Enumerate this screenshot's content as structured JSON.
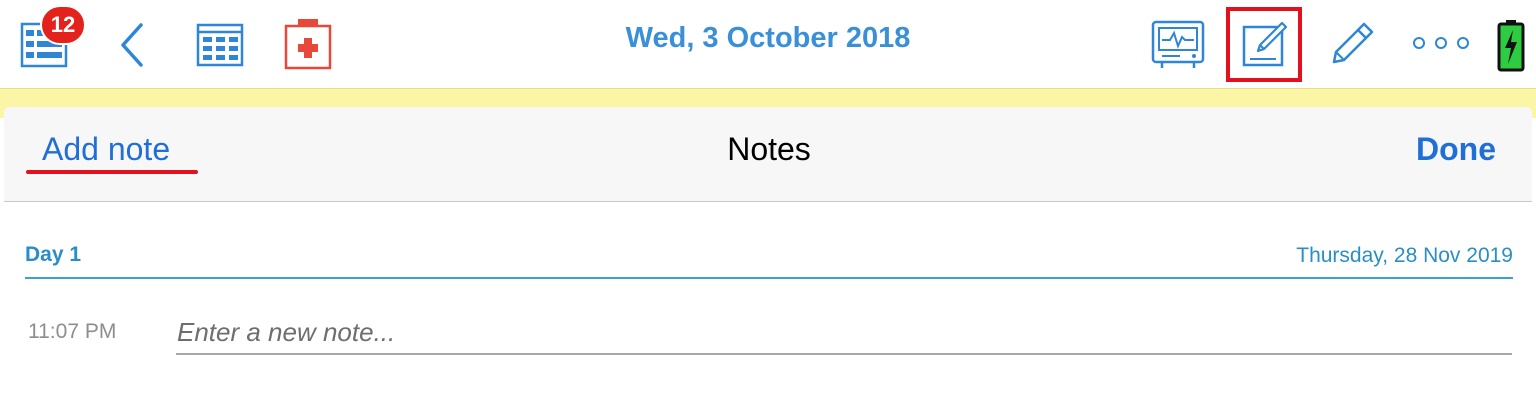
{
  "toolbar": {
    "title": "Wed, 3 October 2018",
    "badge_count": "12",
    "icons": [
      "list-icon",
      "back-chevron-icon",
      "calendar-icon",
      "first-aid-icon",
      "monitor-icon",
      "compose-note-icon",
      "pencil-icon",
      "more-icon",
      "battery-icon"
    ],
    "accent_color": "#3a8fd9",
    "highlight_color": "#e3111d"
  },
  "notes_sheet": {
    "add_note_label": "Add note",
    "title": "Notes",
    "done_label": "Done",
    "day_label": "Day 1",
    "day_date": "Thursday, 28 Nov 2019",
    "entry": {
      "time": "11:07 PM",
      "placeholder": "Enter a new note...",
      "value": ""
    }
  },
  "yellow_strip_color": "#fbf6a6"
}
